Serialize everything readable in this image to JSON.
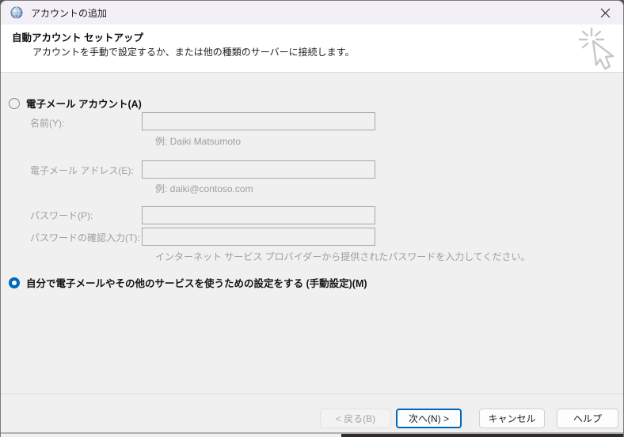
{
  "window": {
    "title": "アカウントの追加",
    "close_icon": "close"
  },
  "header": {
    "title": "自動アカウント セットアップ",
    "subtitle": "アカウントを手動で設定するか、または他の種類のサーバーに接続します。"
  },
  "form": {
    "radio_email": {
      "label": "電子メール アカウント(A)",
      "selected": false
    },
    "fields": [
      {
        "label": "名前(Y):",
        "value": "",
        "example": "例: Daiki Matsumoto"
      },
      {
        "label": "電子メール アドレス(E):",
        "value": "",
        "example": "例: daiki@contoso.com"
      },
      {
        "label": "パスワード(P):",
        "value": ""
      },
      {
        "label": "パスワードの確認入力(T):",
        "value": ""
      }
    ],
    "password_hint": "インターネット サービス プロバイダーから提供されたパスワードを入力してください。",
    "radio_manual": {
      "label": "自分で電子メールやその他のサービスを使うための設定をする (手動設定)(M)",
      "selected": true
    }
  },
  "footer": {
    "back_label": "< 戻る(B)",
    "next_label": "次へ(N) >",
    "cancel_label": "キャンセル",
    "help_label": "ヘルプ"
  },
  "colors": {
    "accent": "#0067c0",
    "titlebar": "#f3eff7",
    "body_background": "#f0f0f0"
  }
}
